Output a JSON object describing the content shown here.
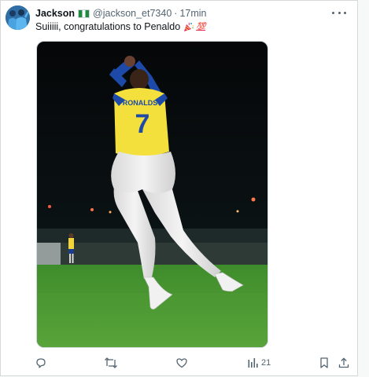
{
  "tweet": {
    "display_name": "Jackson",
    "handle": "@jackson_et7340",
    "separator": "·",
    "time": "17min",
    "text": "Suiiiii, congratulations to Penaldo",
    "emoji_party": "party-popper-icon",
    "emoji_100": "💯"
  },
  "media": {
    "jersey_name": "RONALDS",
    "jersey_number": "7"
  },
  "actions": {
    "views_count": "21"
  },
  "colors": {
    "text_primary": "#0f1419",
    "text_secondary": "#536471",
    "border": "#cfd9de",
    "jersey_yellow": "#f4e03c",
    "jersey_blue": "#1d4aa8",
    "pitch_green": "#4b9a34"
  }
}
